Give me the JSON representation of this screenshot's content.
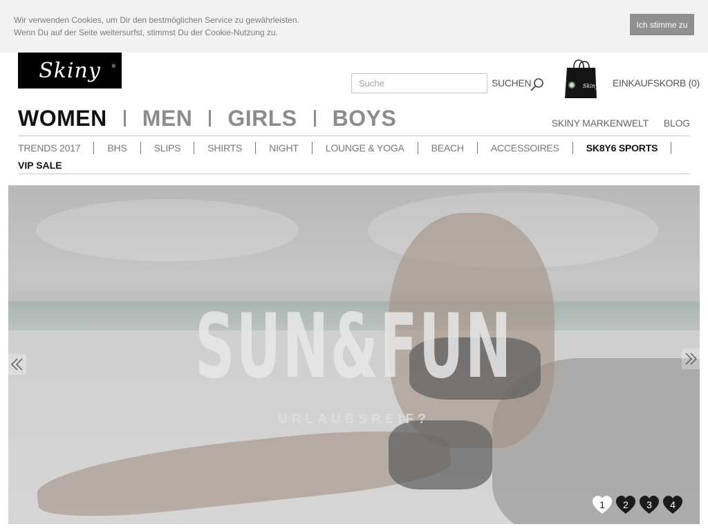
{
  "cookie_bar": {
    "line1": "Wir verwenden Cookies, um Dir den bestmöglichen Service zu gewährleisten.",
    "line2": "Wenn Du auf der Seite weitersurfst, stimmst Du der Cookie-Nutzung zu.",
    "accept_label": "Ich stimme zu"
  },
  "header": {
    "logo_text": "Skiny",
    "logo_reg": "®",
    "search_placeholder": "Suche",
    "search_value": "",
    "search_button_label": "SUCHEN",
    "cart_label": "EINKAUFSKORB (0)"
  },
  "main_nav": [
    "WOMEN",
    "MEN",
    "GIRLS",
    "BOYS"
  ],
  "main_nav_active": "WOMEN",
  "side_links": [
    "SKINY MARKENWELT",
    "BLOG"
  ],
  "sub_nav": [
    "TRENDS 2017",
    "BHS",
    "SLIPS",
    "SHIRTS",
    "NIGHT",
    "LOUNGE & YOGA",
    "BEACH",
    "ACCESSOIRES",
    "SK8Y6 SPORTS"
  ],
  "sub_nav_bold": "SK8Y6 SPORTS",
  "vip_label": "VIP SALE",
  "hero": {
    "headline": "SUN&FUN",
    "subline": "URLAUBSREIF?",
    "slides": [
      "1",
      "2",
      "3",
      "4"
    ],
    "active_slide": "1"
  },
  "colors": {
    "cookie_bg": "#f2f2f2",
    "cookie_button": "#8f8f8f",
    "nav_active": "#111111",
    "nav_inactive": "#8c8c8c"
  }
}
